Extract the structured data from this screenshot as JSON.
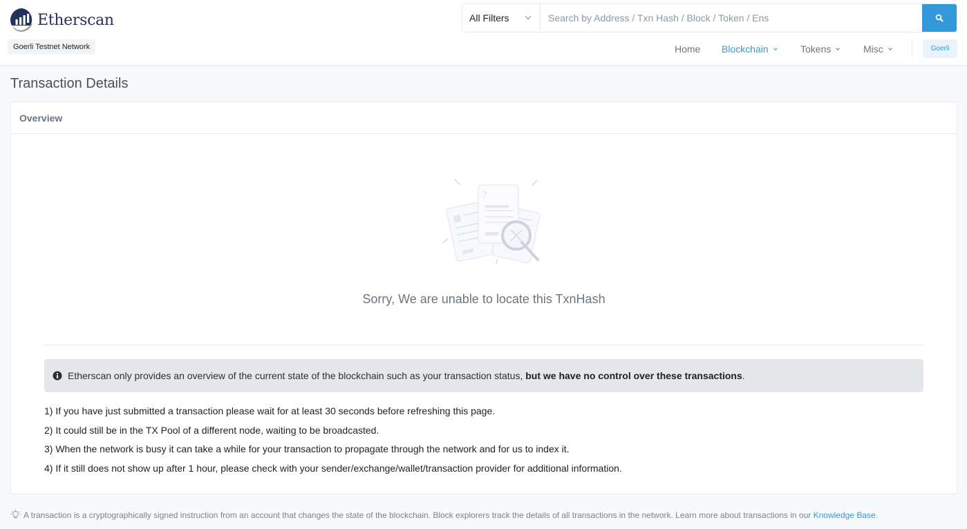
{
  "brand": {
    "name": "Etherscan",
    "network_label": "Goerli Testnet Network"
  },
  "search": {
    "filter_selected": "All Filters",
    "placeholder": "Search by Address / Txn Hash / Block / Token / Ens",
    "value": ""
  },
  "nav": {
    "items": [
      {
        "label": "Home",
        "dropdown": false,
        "active": false
      },
      {
        "label": "Blockchain",
        "dropdown": true,
        "active": true
      },
      {
        "label": "Tokens",
        "dropdown": true,
        "active": false
      },
      {
        "label": "Misc",
        "dropdown": true,
        "active": false
      }
    ],
    "network_button": "Goerli"
  },
  "page": {
    "title": "Transaction Details"
  },
  "card": {
    "header": "Overview",
    "not_found_message": "Sorry, We are unable to locate this TxnHash",
    "alert": {
      "icon": "info-circle-icon",
      "text": "Etherscan only provides an overview of the current state of the blockchain such as your transaction status,",
      "bold": "but we have no control over these transactions",
      "suffix": "."
    },
    "tips": [
      "1) If you have just submitted a transaction please wait for at least 30 seconds before refreshing this page.",
      "2) It could still be in the TX Pool of a different node, waiting to be broadcasted.",
      "3) When the network is busy it can take a while for your transaction to propagate through the network and for us to index it.",
      "4) If it still does not show up after 1 hour, please check with your sender/exchange/wallet/transaction provider for additional information."
    ]
  },
  "footnote": {
    "icon": "lightbulb-icon",
    "text": "A transaction is a cryptographically signed instruction from an account that changes the state of the blockchain. Block explorers track the details of all transactions in the network. Learn more about transactions in our",
    "link_label": "Knowledge Base",
    "suffix": "."
  },
  "colors": {
    "accent": "#3498db",
    "brand_navy": "#21325b",
    "muted_text": "#6c757e"
  }
}
